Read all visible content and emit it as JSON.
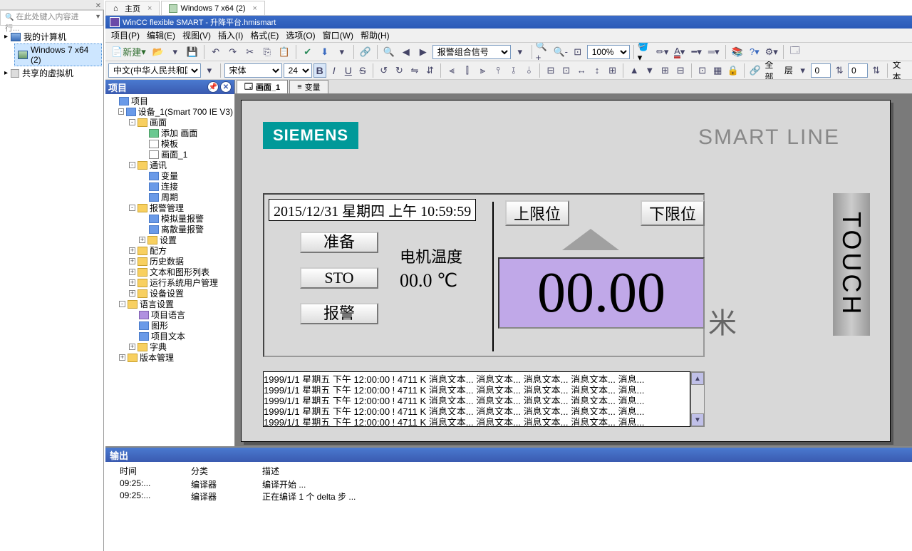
{
  "host_tabs": [
    {
      "label": "主页",
      "icon": "home-icon"
    },
    {
      "label": "Windows 7 x64 (2)",
      "icon": "vm-icon",
      "closable": true
    }
  ],
  "vm_sidebar": {
    "search_placeholder": "在此处键入内容进行...",
    "root": "我的计算机",
    "items": [
      "Windows 7 x64 (2)"
    ],
    "shared": "共享的虚拟机"
  },
  "app_title": "WinCC flexible SMART - 升降平台.hmismart",
  "menu": [
    "项目(P)",
    "编辑(E)",
    "视图(V)",
    "插入(I)",
    "格式(E)",
    "选项(O)",
    "窗口(W)",
    "帮助(H)"
  ],
  "toolbar1": {
    "new_label": "新建",
    "alarm_combo": "报警组合信号",
    "zoom": "100%"
  },
  "toolbar2": {
    "lang": "中文(中华人民共和国)",
    "font": "宋体",
    "size": "24",
    "layer_label": "全部",
    "layer2_label": "层",
    "num1": "0",
    "num2": "0",
    "text_btn": "文本"
  },
  "project_panel": {
    "title": "项目",
    "tree": [
      {
        "d": 0,
        "exp": "",
        "ico": "f-blue",
        "label": "项目"
      },
      {
        "d": 1,
        "exp": "-",
        "ico": "f-blue",
        "label": "设备_1(Smart 700 IE V3)"
      },
      {
        "d": 2,
        "exp": "-",
        "ico": "f-yel",
        "label": "画面"
      },
      {
        "d": 3,
        "exp": "",
        "ico": "f-grn",
        "label": "添加 画面"
      },
      {
        "d": 3,
        "exp": "",
        "ico": "f-wht",
        "label": "模板"
      },
      {
        "d": 3,
        "exp": "",
        "ico": "f-wht",
        "label": "画面_1"
      },
      {
        "d": 2,
        "exp": "-",
        "ico": "f-yel",
        "label": "通讯"
      },
      {
        "d": 3,
        "exp": "",
        "ico": "f-blue",
        "label": "变量"
      },
      {
        "d": 3,
        "exp": "",
        "ico": "f-blue",
        "label": "连接"
      },
      {
        "d": 3,
        "exp": "",
        "ico": "f-blue",
        "label": "周期"
      },
      {
        "d": 2,
        "exp": "-",
        "ico": "f-yel",
        "label": "报警管理"
      },
      {
        "d": 3,
        "exp": "",
        "ico": "f-blue",
        "label": "模拟量报警"
      },
      {
        "d": 3,
        "exp": "",
        "ico": "f-blue",
        "label": "离散量报警"
      },
      {
        "d": 3,
        "exp": "+",
        "ico": "f-yel",
        "label": "设置"
      },
      {
        "d": 2,
        "exp": "+",
        "ico": "f-yel",
        "label": "配方"
      },
      {
        "d": 2,
        "exp": "+",
        "ico": "f-yel",
        "label": "历史数据"
      },
      {
        "d": 2,
        "exp": "+",
        "ico": "f-yel",
        "label": "文本和图形列表"
      },
      {
        "d": 2,
        "exp": "+",
        "ico": "f-yel",
        "label": "运行系统用户管理"
      },
      {
        "d": 2,
        "exp": "+",
        "ico": "f-yel",
        "label": "设备设置"
      },
      {
        "d": 1,
        "exp": "-",
        "ico": "f-yel",
        "label": "语言设置"
      },
      {
        "d": 2,
        "exp": "",
        "ico": "f-pur",
        "label": "项目语言"
      },
      {
        "d": 2,
        "exp": "",
        "ico": "f-blue",
        "label": "图形"
      },
      {
        "d": 2,
        "exp": "",
        "ico": "f-blue",
        "label": "项目文本"
      },
      {
        "d": 2,
        "exp": "+",
        "ico": "f-yel",
        "label": "字典"
      },
      {
        "d": 1,
        "exp": "+",
        "ico": "f-yel",
        "label": "版本管理"
      }
    ]
  },
  "editor_tabs": [
    {
      "label": "画面_1",
      "active": true
    },
    {
      "label": "变量",
      "active": false
    }
  ],
  "hmi": {
    "logo": "SIEMENS",
    "brand": "SMART LINE",
    "datetime": "2015/12/31 星期四 上午 10:59:59",
    "btn_ready": "准备",
    "btn_sto": "STO",
    "btn_alarm": "报警",
    "temp_label": "电机温度",
    "temp_value": "00.0 ℃",
    "limit_up": "上限位",
    "limit_down": "下限位",
    "big_value": "00.00",
    "unit": "米",
    "touch": "TOUCH",
    "msg_line": "1999/1/1 星期五 下午 12:00:00 ! 4711 K 消息文本... 消息文本... 消息文本... 消息文本... 消息..."
  },
  "output": {
    "title": "输出",
    "col_time": "时间",
    "col_cat": "分类",
    "col_desc": "描述",
    "rows": [
      {
        "time": "09:25:...",
        "cat": "编译器",
        "desc": "编译开始 ..."
      },
      {
        "time": "09:25:...",
        "cat": "编译器",
        "desc": "正在编译 1 个 delta 步 ..."
      }
    ]
  }
}
